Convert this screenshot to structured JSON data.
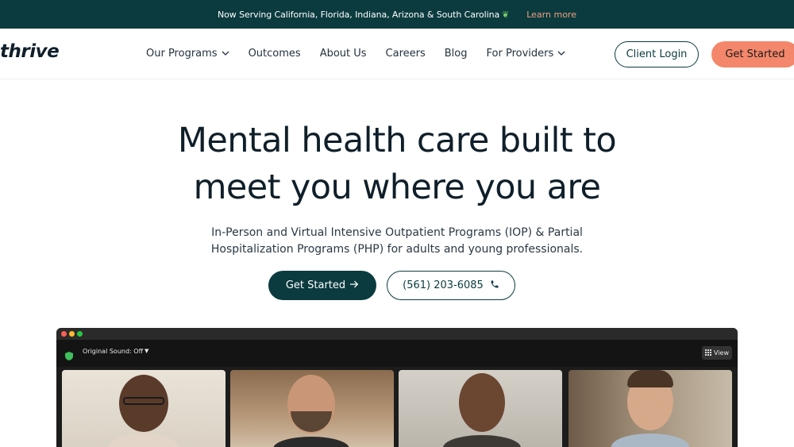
{
  "topbar": {
    "message": "Now Serving California, Florida, Indiana, Arizona & South Carolina",
    "leaf_icon": "leaf-icon",
    "learn_more": "Learn more"
  },
  "nav": {
    "logo": "thrive",
    "items": [
      {
        "label": "Our Programs",
        "dropdown": true
      },
      {
        "label": "Outcomes",
        "dropdown": false
      },
      {
        "label": "About Us",
        "dropdown": false
      },
      {
        "label": "Careers",
        "dropdown": false
      },
      {
        "label": "Blog",
        "dropdown": false
      },
      {
        "label": "For Providers",
        "dropdown": true
      }
    ],
    "client_login": "Client Login",
    "get_started": "Get Started"
  },
  "hero": {
    "title_line1": "Mental health care built to",
    "title_line2": "meet you where you are",
    "subtitle_line1": "In-Person and Virtual Intensive Outpatient Programs (IOP) & Partial",
    "subtitle_line2": "Hospitalization Programs (PHP) for adults and young professionals.",
    "cta_primary": "Get Started",
    "cta_phone": "(561) 203-6085"
  },
  "video_call": {
    "sound_label": "Original Sound: Off",
    "view_label": "View",
    "participants": 4
  },
  "colors": {
    "brand_dark": "#0b3b3f",
    "accent": "#f4876b"
  }
}
